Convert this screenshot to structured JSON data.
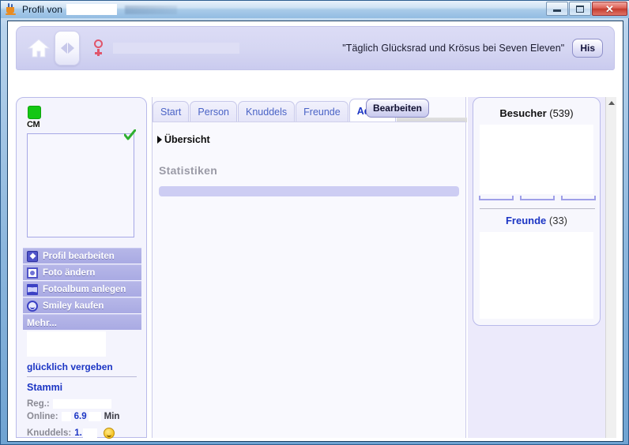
{
  "window": {
    "title": "Profil von",
    "app_icon": "java-icon",
    "buttons": {
      "minimize": "minimize-icon",
      "maximize": "maximize-icon",
      "close": "✕"
    }
  },
  "banner": {
    "home_icon": "home-icon",
    "nav_back_icon": "arrow-left-icon",
    "nav_forward_icon": "arrow-right-icon",
    "gender_icon": "female-gender-icon",
    "tagline": "\"Täglich Glücksrad und Krösus bei Seven Eleven\"",
    "history_button": "His"
  },
  "sidebar": {
    "status_indicator": "online-status-green",
    "nick_label": "CM",
    "photo_verified_icon": "green-check-icon",
    "menu": [
      {
        "label": "Profil bearbeiten",
        "icon": "pencil-icon"
      },
      {
        "label": "Foto ändern",
        "icon": "photo-icon"
      },
      {
        "label": "Fotoalbum anlegen",
        "icon": "album-icon"
      },
      {
        "label": "Smiley kaufen",
        "icon": "smiley-icon"
      }
    ],
    "more_label": "Mehr...",
    "relationship_status": "glücklich vergeben",
    "membership": "Stammi",
    "stats": {
      "reg_label": "Reg.:",
      "reg_value": "",
      "online_label": "Online:",
      "online_value": "6.9",
      "online_unit": "Min",
      "knuddels_label": "Knuddels:",
      "knuddels_value": "1.",
      "knuddels_icon": "smiley-icon"
    }
  },
  "main": {
    "tabs": [
      {
        "label": "Start",
        "active": false
      },
      {
        "label": "Person",
        "active": false
      },
      {
        "label": "Knuddels",
        "active": false
      },
      {
        "label": "Freunde",
        "active": false
      },
      {
        "label": "Admin",
        "active": true
      }
    ],
    "edit_button": "Bearbeiten",
    "section_heading": "Übersicht",
    "statistics_heading": "Statistiken"
  },
  "right_panel": {
    "visitors_label": "Besucher",
    "visitors_count": "(539)",
    "friends_label": "Freunde",
    "friends_count": "(33)"
  },
  "scrollbar": {
    "up_arrow_icon": "caret-up-icon"
  },
  "colors": {
    "accent_purple": "#b6b7e8",
    "link_blue": "#1b35c4",
    "online_green": "#14c714",
    "panel_bg": "#f4f4fd"
  }
}
